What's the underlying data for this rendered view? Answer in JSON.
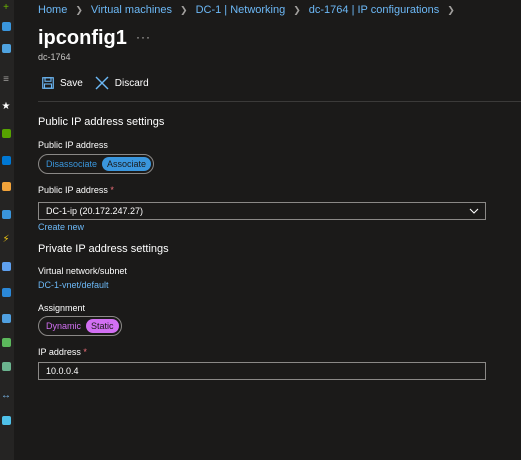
{
  "breadcrumb": [
    "Home",
    "Virtual machines",
    "DC-1 | Networking",
    "dc-1764 | IP configurations"
  ],
  "page": {
    "title": "ipconfig1",
    "more_label": "···",
    "subtitle": "dc-1764"
  },
  "toolbar": {
    "save_label": "Save",
    "discard_label": "Discard"
  },
  "public_ip_section": {
    "heading": "Public IP address settings",
    "toggle_label": "Public IP address",
    "toggle_options": [
      "Disassociate",
      "Associate"
    ],
    "selected_option": "Associate",
    "select_label": "Public IP address",
    "required_mark": "*",
    "select_value": "DC-1-ip (20.172.247.27)",
    "create_new_link": "Create new"
  },
  "private_ip_section": {
    "heading": "Private IP address settings",
    "vnet_label": "Virtual network/subnet",
    "vnet_value": "DC-1-vnet/default",
    "assignment_label": "Assignment",
    "assignment_options": [
      "Dynamic",
      "Static"
    ],
    "selected_assignment": "Static",
    "ip_label": "IP address",
    "required_mark": "*",
    "ip_value": "10.0.0.4"
  },
  "leftnav": {
    "icons": [
      "plus-icon",
      "home-icon",
      "dashboard-icon",
      "menu-icon",
      "star-icon",
      "all-resources-icon",
      "resource-groups-icon",
      "quickstart-icon",
      "app-services-icon",
      "function-app-icon",
      "sql-icon",
      "cosmos-icon",
      "virtual-machines-icon",
      "load-balancer-icon",
      "storage-icon",
      "virtual-network-icon",
      "entra-icon"
    ]
  },
  "colors": {
    "background": "#1b1a19",
    "nav": "#252423",
    "link": "#6cb8f6",
    "associate_active": "#3a96dd",
    "static_active": "#d26ff3",
    "dynamic_text": "#d26ff3",
    "required": "#f1707b"
  }
}
